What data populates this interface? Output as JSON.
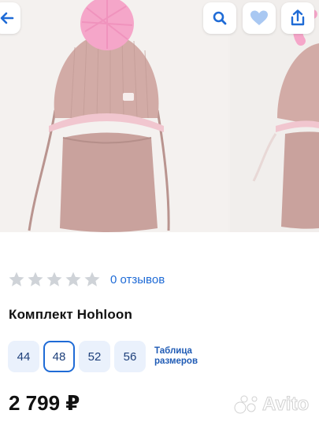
{
  "icons": {
    "back": "arrow-left-icon",
    "search": "search-icon",
    "favorite": "heart-icon",
    "share": "share-icon"
  },
  "colors": {
    "accent": "#1f6bd6",
    "star_empty": "#cfd3d8",
    "size_chip_bg": "#eaf1fc",
    "product_pink": "#cfa7a2",
    "pompom_pink": "#f4a3c8"
  },
  "rating": {
    "stars_filled": 0,
    "stars_total": 5,
    "reviews_text": "0 отзывов"
  },
  "product": {
    "title": "Комплект Hohloon",
    "price": "2 799 ₽"
  },
  "sizes": {
    "options": [
      "44",
      "48",
      "52",
      "56"
    ],
    "selected": "48",
    "table_link": "Таблица размеров"
  },
  "watermark": {
    "text": "Avito"
  }
}
